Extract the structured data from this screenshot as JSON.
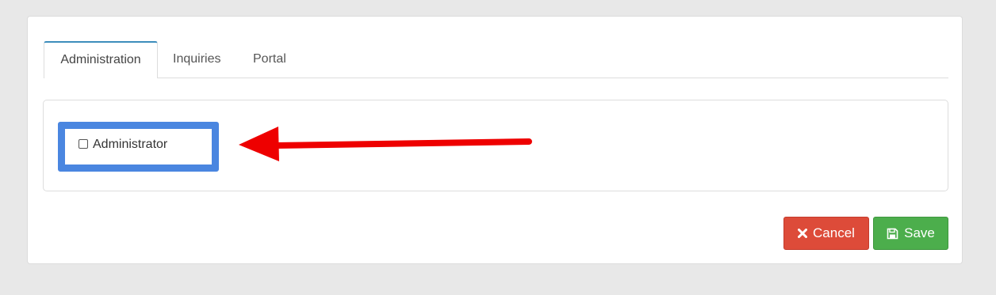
{
  "tabs": [
    {
      "label": "Administration",
      "active": true
    },
    {
      "label": "Inquiries",
      "active": false
    },
    {
      "label": "Portal",
      "active": false
    }
  ],
  "admin_option": {
    "label": "Administrator",
    "checked": false
  },
  "buttons": {
    "cancel_label": "Cancel",
    "save_label": "Save"
  },
  "colors": {
    "tab_accent": "#3c8dbc",
    "highlight_border": "#4a86e0",
    "annotation_arrow": "#ee0000",
    "cancel_bg": "#dd4b39",
    "save_bg": "#4cae4c"
  },
  "icons": {
    "cancel": "close-icon",
    "save": "floppy-disk-icon",
    "annotation": "arrow-left-icon"
  }
}
